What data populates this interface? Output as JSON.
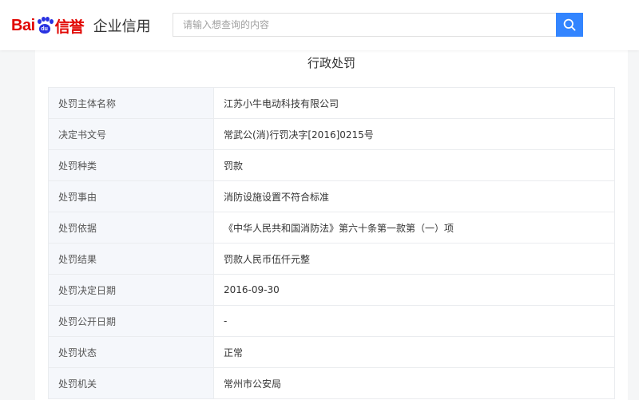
{
  "header": {
    "logo_bai": "Bai",
    "logo_du": "du",
    "logo_xinyu": "信誉",
    "logo_subtitle": "企业信用",
    "search_placeholder": "请输入想查询的内容",
    "search_icon": "search-icon",
    "accent_color": "#3385ff",
    "brand_red": "#e10602",
    "brand_blue": "#2932e1"
  },
  "section": {
    "title": "行政处罚"
  },
  "rows": [
    {
      "label": "处罚主体名称",
      "value": "江苏小牛电动科技有限公司"
    },
    {
      "label": "决定书文号",
      "value": "常武公(消)行罚决字[2016]0215号"
    },
    {
      "label": "处罚种类",
      "value": "罚款"
    },
    {
      "label": "处罚事由",
      "value": "消防设施设置不符合标准"
    },
    {
      "label": "处罚依据",
      "value": "《中华人民共和国消防法》第六十条第一款第（一）项"
    },
    {
      "label": "处罚结果",
      "value": "罚款人民币伍仟元整"
    },
    {
      "label": "处罚决定日期",
      "value": "2016-09-30"
    },
    {
      "label": "处罚公开日期",
      "value": "-"
    },
    {
      "label": "处罚状态",
      "value": "正常"
    },
    {
      "label": "处罚机关",
      "value": "常州市公安局"
    }
  ]
}
